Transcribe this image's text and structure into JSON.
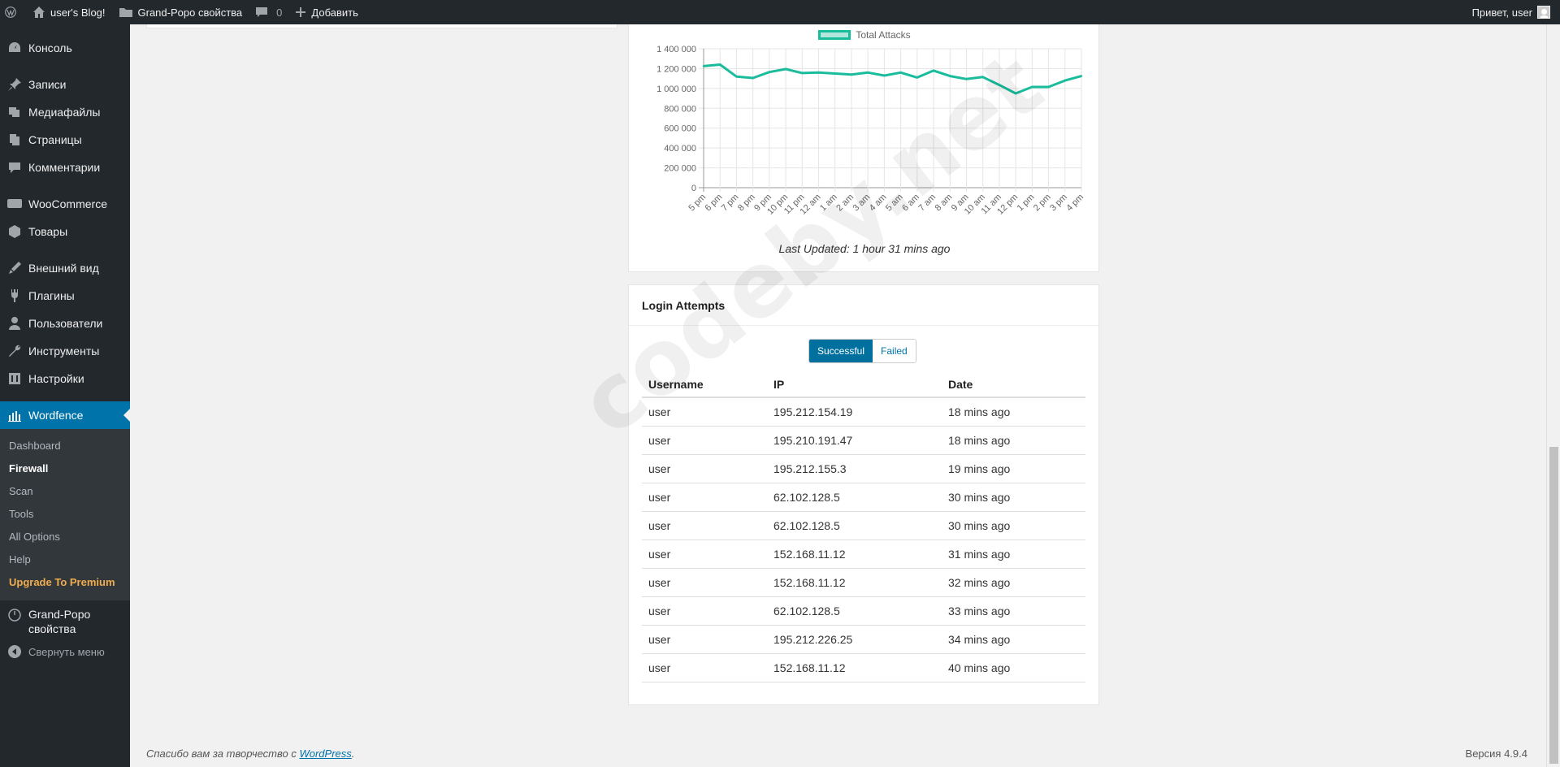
{
  "adminbar": {
    "site_name": "user's Blog!",
    "theme_link": "Grand-Popo свойства",
    "comments_count": "0",
    "add_new": "Добавить",
    "greeting": "Привет, user"
  },
  "sidebar": {
    "items": [
      {
        "label": "Консоль",
        "icon": "dashboard-icon"
      },
      {
        "label": "Записи",
        "icon": "pin-icon"
      },
      {
        "label": "Медиафайлы",
        "icon": "media-icon"
      },
      {
        "label": "Страницы",
        "icon": "pages-icon"
      },
      {
        "label": "Комментарии",
        "icon": "comments-icon"
      },
      {
        "label": "WooCommerce",
        "icon": "woo-icon"
      },
      {
        "label": "Товары",
        "icon": "products-icon"
      },
      {
        "label": "Внешний вид",
        "icon": "appearance-icon"
      },
      {
        "label": "Плагины",
        "icon": "plugins-icon"
      },
      {
        "label": "Пользователи",
        "icon": "users-icon"
      },
      {
        "label": "Инструменты",
        "icon": "tools-icon"
      },
      {
        "label": "Настройки",
        "icon": "settings-icon"
      },
      {
        "label": "Wordfence",
        "icon": "wordfence-icon"
      }
    ],
    "submenu": [
      "Dashboard",
      "Firewall",
      "Scan",
      "Tools",
      "All Options",
      "Help",
      "Upgrade To Premium"
    ],
    "theme_item": "Grand-Popo свойства",
    "collapse": "Свернуть меню"
  },
  "chart_card": {
    "last_updated": "Last Updated: 1 hour 31 mins ago"
  },
  "chart_data": {
    "type": "line",
    "series": [
      {
        "name": "Total Attacks",
        "color": "#1abc9c",
        "values": [
          1225000,
          1240000,
          1120000,
          1105000,
          1165000,
          1195000,
          1155000,
          1160000,
          1150000,
          1140000,
          1160000,
          1130000,
          1160000,
          1110000,
          1180000,
          1125000,
          1095000,
          1115000,
          1035000,
          950000,
          1015000,
          1015000,
          1080000,
          1125000
        ]
      }
    ],
    "categories": [
      "5 pm",
      "6 pm",
      "7 pm",
      "8 pm",
      "9 pm",
      "10 pm",
      "11 pm",
      "12 am",
      "1 am",
      "2 am",
      "3 am",
      "4 am",
      "5 am",
      "6 am",
      "7 am",
      "8 am",
      "9 am",
      "10 am",
      "11 am",
      "12 pm",
      "1 pm",
      "2 pm",
      "3 pm",
      "4 pm"
    ],
    "yticks": [
      "0",
      "200 000",
      "400 000",
      "600 000",
      "800 000",
      "1 000 000",
      "1 200 000",
      "1 400 000"
    ],
    "ylim": [
      0,
      1400000
    ],
    "grid": true,
    "legend": "top"
  },
  "login_card": {
    "title": "Login Attempts",
    "toggle_successful": "Successful",
    "toggle_failed": "Failed",
    "columns": [
      "Username",
      "IP",
      "Date"
    ],
    "rows": [
      [
        "user",
        "195.212.154.19",
        "18 mins ago"
      ],
      [
        "user",
        "195.210.191.47",
        "18 mins ago"
      ],
      [
        "user",
        "195.212.155.3",
        "19 mins ago"
      ],
      [
        "user",
        "62.102.128.5",
        "30 mins ago"
      ],
      [
        "user",
        "62.102.128.5",
        "30 mins ago"
      ],
      [
        "user",
        "152.168.11.12",
        "31 mins ago"
      ],
      [
        "user",
        "152.168.11.12",
        "32 mins ago"
      ],
      [
        "user",
        "62.102.128.5",
        "33 mins ago"
      ],
      [
        "user",
        "195.212.226.25",
        "34 mins ago"
      ],
      [
        "user",
        "152.168.11.12",
        "40 mins ago"
      ]
    ]
  },
  "watermark": "codeby.net",
  "footer": {
    "thanks": "Спасибо вам за творчество с",
    "link": "WordPress",
    "version": "Версия 4.9.4"
  }
}
